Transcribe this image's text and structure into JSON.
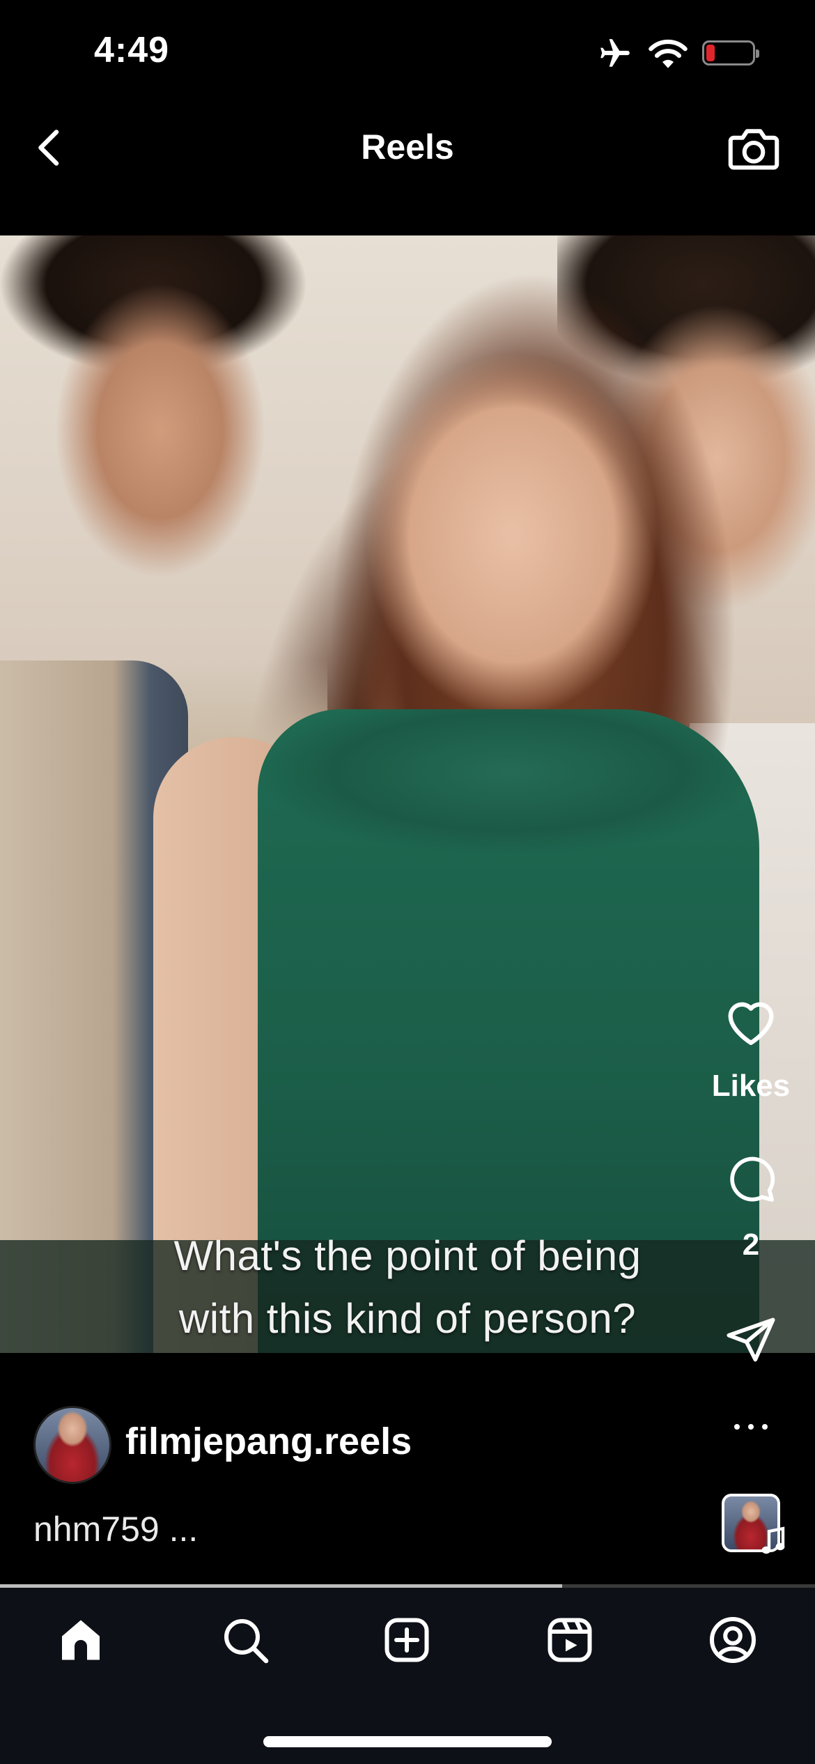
{
  "status_bar": {
    "time": "4:49",
    "icons": [
      "airplane-icon",
      "wifi-icon",
      "battery-icon"
    ],
    "battery_color": "#e0262a"
  },
  "header": {
    "title": "Reels",
    "back_icon": "chevron-left-icon",
    "camera_icon": "camera-icon"
  },
  "video": {
    "subtitle_lines": [
      "What's the point of being",
      "with this kind of person?"
    ]
  },
  "actions": {
    "likes_label": "Likes",
    "comments_count": "2",
    "icons": [
      "heart-icon",
      "comment-icon",
      "send-icon",
      "more-icon"
    ]
  },
  "author": {
    "username": "filmjepang.reels",
    "caption": "nhm759 ..."
  },
  "progress": {
    "fraction": 0.69
  },
  "tabs": [
    {
      "name": "home",
      "icon": "home-icon",
      "active": true
    },
    {
      "name": "search",
      "icon": "search-icon",
      "active": false
    },
    {
      "name": "create",
      "icon": "plus-square-icon",
      "active": false
    },
    {
      "name": "reels",
      "icon": "reels-icon",
      "active": false
    },
    {
      "name": "profile",
      "icon": "profile-icon",
      "active": false
    }
  ]
}
